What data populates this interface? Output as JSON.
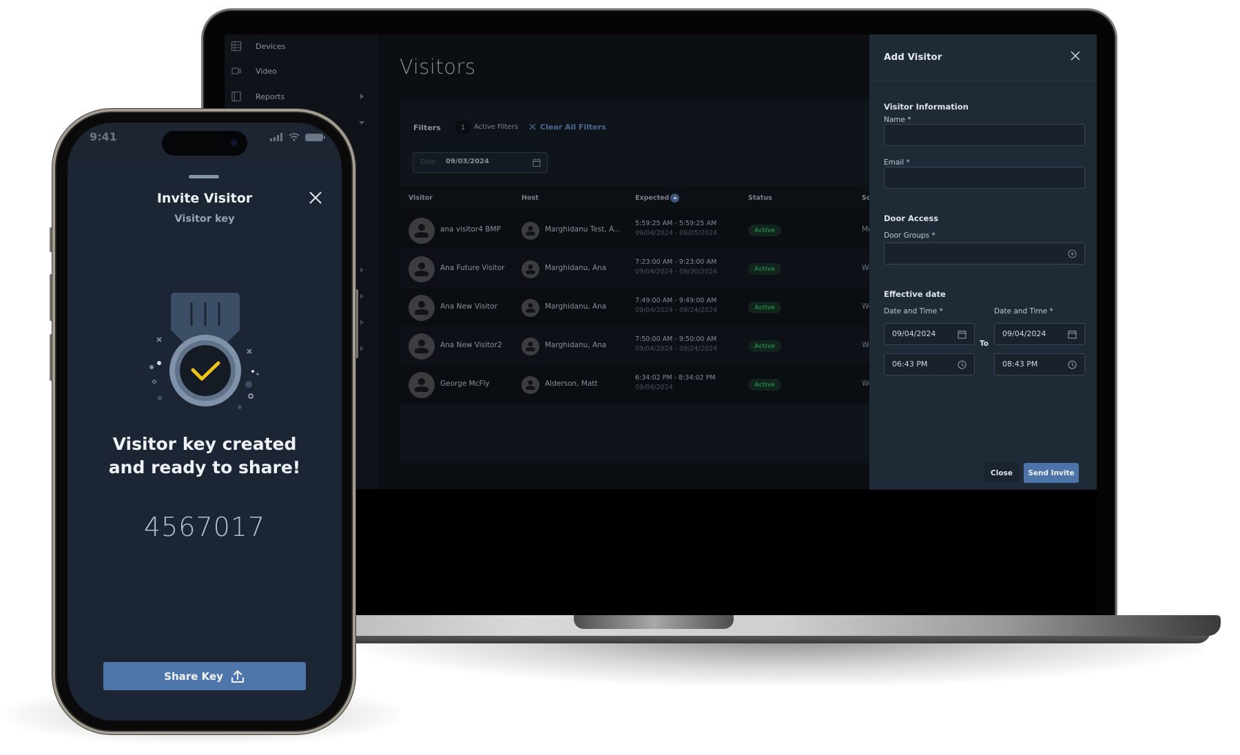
{
  "laptop": {
    "sidebar": {
      "items": [
        {
          "label": "Devices",
          "icon": "devices-icon"
        },
        {
          "label": "Video",
          "icon": "video-camera-icon"
        },
        {
          "label": "Reports",
          "icon": "reports-icon",
          "has_submenu": true
        }
      ]
    },
    "page_title": "Visitors",
    "filters": {
      "label": "Filters",
      "active_count": "1",
      "active_label": "Active Filters",
      "clear_label": "Clear All Filters",
      "date_label": "Date",
      "date_value": "09/03/2024"
    },
    "table": {
      "columns": [
        "Visitor",
        "Host",
        "Expected",
        "Status",
        "So"
      ],
      "rows": [
        {
          "visitor": "ana visitor4 BMP",
          "host": "Marghidanu Test, A...",
          "time": "5:59:25 AM - 5:59:25 AM",
          "date": "09/04/2024 - 09/05/2024",
          "status": "Active",
          "source": "Mo"
        },
        {
          "visitor": "Ana Future Visitor",
          "host": "Marghidanu, Ana",
          "time": "7:23:00 AM - 9:23:00 AM",
          "date": "09/04/2024 - 09/30/2024",
          "status": "Active",
          "source": "We"
        },
        {
          "visitor": "Ana New Visitor",
          "host": "Marghidanu, Ana",
          "time": "7:49:00 AM - 9:49:00 AM",
          "date": "09/04/2024 - 09/24/2024",
          "status": "Active",
          "source": "We"
        },
        {
          "visitor": "Ana New Visitor2",
          "host": "Marghidanu, Ana",
          "time": "7:50:00 AM - 9:50:00 AM",
          "date": "09/04/2024 - 09/24/2024",
          "status": "Active",
          "source": "We"
        },
        {
          "visitor": "George McFly",
          "host": "Alderson, Matt",
          "time": "6:34:02 PM - 8:34:02 PM",
          "date": "09/04/2024",
          "status": "Active",
          "source": "We"
        }
      ]
    },
    "add_visitor": {
      "title": "Add Visitor",
      "visitor_info_heading": "Visitor Information",
      "name_label": "Name *",
      "name_value": "",
      "email_label": "Email *",
      "email_value": "",
      "door_access_heading": "Door Access",
      "door_groups_label": "Door Groups *",
      "door_groups_value": "",
      "effective_date_heading": "Effective date",
      "start": {
        "label": "Date and Time *",
        "date": "09/04/2024",
        "time": "06:43 PM"
      },
      "to_label": "To",
      "end": {
        "label": "Date and Time *",
        "date": "09/04/2024",
        "time": "08:43 PM"
      },
      "close_label": "Close",
      "send_label": "Send Invite"
    },
    "colors": {
      "accent": "#4d74a8",
      "panel_bg": "#1f2a37",
      "active_badge": "#1f7a46"
    }
  },
  "phone": {
    "status_time": "9:41",
    "title": "Invite Visitor",
    "subtitle": "Visitor key",
    "message_line1": "Visitor key created",
    "message_line2": "and ready to share!",
    "key_code": "4567017",
    "share_label": "Share Key",
    "colors": {
      "accent": "#4f76aa",
      "checkmark": "#f0c419",
      "bg": "#1c2533"
    }
  }
}
